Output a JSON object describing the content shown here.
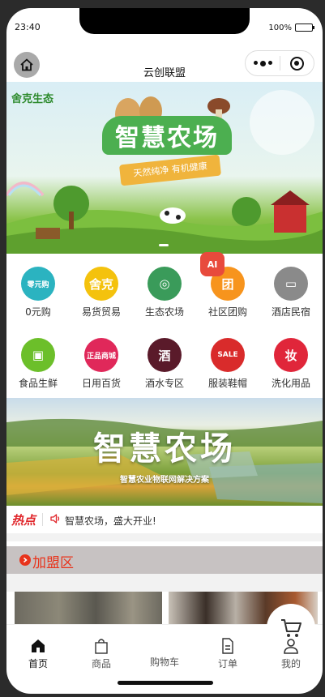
{
  "status_bar": {
    "time": "23:40",
    "battery": "100%"
  },
  "nav": {
    "title": "云创联盟"
  },
  "banner": {
    "brand": "舍克生态",
    "title": "智慧农场",
    "subtitle": "天然纯净 有机健康"
  },
  "grid": [
    {
      "label": "0元购",
      "icon": "zero-buy-icon",
      "color": "#2bb3c0",
      "glyph": "零元购"
    },
    {
      "label": "易货贸易",
      "icon": "barter-icon",
      "color": "#f4c20d",
      "glyph": "舍克"
    },
    {
      "label": "生态农场",
      "icon": "eco-farm-icon",
      "color": "#3a9b5a",
      "glyph": "◎"
    },
    {
      "label": "社区团购",
      "icon": "group-buy-icon",
      "color": "#f7941d",
      "glyph": "团"
    },
    {
      "label": "酒店民宿",
      "icon": "hotel-icon",
      "color": "#8a8a8a",
      "glyph": "▭"
    },
    {
      "label": "食品生鲜",
      "icon": "fresh-food-icon",
      "color": "#6cbf2a",
      "glyph": "▣"
    },
    {
      "label": "日用百货",
      "icon": "daily-goods-icon",
      "color": "#e0285a",
      "glyph": "正品商城"
    },
    {
      "label": "酒水专区",
      "icon": "liquor-icon",
      "color": "#5a1a2a",
      "glyph": "酒"
    },
    {
      "label": "服装鞋帽",
      "icon": "clothing-icon",
      "color": "#d92b2b",
      "glyph": "SALE"
    },
    {
      "label": "洗化用品",
      "icon": "cosmetics-icon",
      "color": "#e0263a",
      "glyph": "妆"
    }
  ],
  "ai_badge": "AI",
  "farm_banner": {
    "title": "智慧农场",
    "subtitle": "智慧农业物联网解决方案"
  },
  "hot": {
    "logo": "热点",
    "text": "智慧农场，盛大开业!"
  },
  "section": {
    "title": "加盟区"
  },
  "tabs": [
    {
      "label": "首页",
      "icon": "home-icon",
      "active": true
    },
    {
      "label": "商品",
      "icon": "bag-icon",
      "active": false
    },
    {
      "label": "购物车",
      "icon": "cart-icon",
      "active": false
    },
    {
      "label": "订单",
      "icon": "order-icon",
      "active": false
    },
    {
      "label": "我的",
      "icon": "profile-icon",
      "active": false
    }
  ],
  "colors": {
    "accent": "#e8341c",
    "section_bg": "#c7c2c2"
  }
}
